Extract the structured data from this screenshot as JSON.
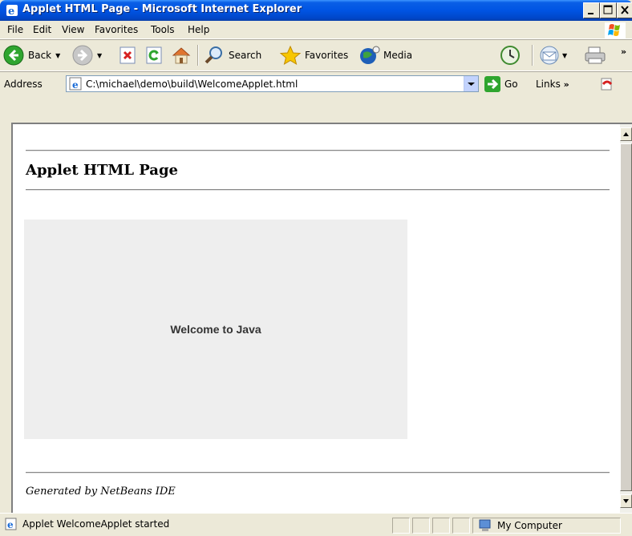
{
  "window": {
    "title": "Applet HTML Page - Microsoft Internet Explorer"
  },
  "menu": [
    "File",
    "Edit",
    "View",
    "Favorites",
    "Tools",
    "Help"
  ],
  "toolbar": {
    "back_label": "Back",
    "search_label": "Search",
    "favorites_label": "Favorites",
    "media_label": "Media"
  },
  "address": {
    "label": "Address",
    "value": "C:\\michael\\demo\\build\\WelcomeApplet.html",
    "go_label": "Go",
    "links_label": "Links"
  },
  "page": {
    "heading": "Applet HTML Page",
    "applet_text": "Welcome to Java",
    "footer": "Generated by NetBeans IDE"
  },
  "status": {
    "text": "Applet WelcomeApplet started",
    "zone": "My Computer"
  },
  "colors": {
    "titlebar": "#0054E3",
    "chrome": "#ECE9D8",
    "applet_bg": "#EEEEEE"
  },
  "icons": [
    "ie-icon",
    "minimize-icon",
    "maximize-icon",
    "close-icon",
    "back-icon",
    "forward-icon",
    "stop-icon",
    "refresh-icon",
    "home-icon",
    "search-icon",
    "favorites-icon",
    "media-icon",
    "history-icon",
    "mail-icon",
    "print-icon",
    "go-icon",
    "my-computer-icon"
  ]
}
